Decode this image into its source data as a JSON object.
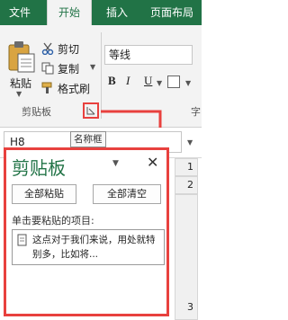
{
  "ribbon": {
    "tabs": [
      {
        "label": "文件"
      },
      {
        "label": "开始"
      },
      {
        "label": "插入"
      },
      {
        "label": "页面布局"
      }
    ],
    "paste_label": "粘贴",
    "cut_label": "剪切",
    "copy_label": "复制",
    "format_painter_label": "格式刷",
    "group_label": "剪贴板",
    "font_value": "等线",
    "bold": "B",
    "italic": "I",
    "underline": "U",
    "edge_label": "字"
  },
  "formula_bar": {
    "name_box_value": "H8",
    "tooltip": "名称框"
  },
  "clipboard_pane": {
    "title": "剪贴板",
    "paste_all_label": "全部粘贴",
    "clear_all_label": "全部清空",
    "items_label": "单击要粘贴的项目:",
    "clip_item_text": "这点对于我们来说，用处就特别多，比如将..."
  },
  "rows": [
    "1",
    "2",
    "3"
  ],
  "colors": {
    "excel_green": "#217346",
    "highlight_red": "#e8413e"
  }
}
